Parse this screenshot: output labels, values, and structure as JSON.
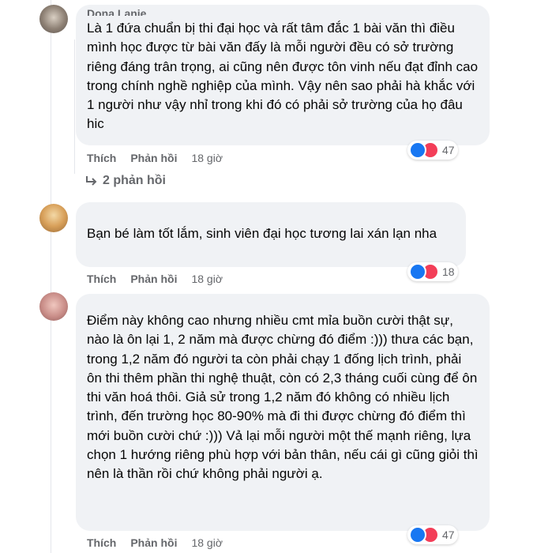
{
  "comments": [
    {
      "author": "Dona Lanie",
      "text": "Là 1 đứa chuẩn bị thi đại học và rất tâm đắc 1 bài văn thì điều mình học được từ bài văn đấy là mỗi người đều có sở trường riêng đáng trân trọng, ai cũng nên được tôn vinh nếu đạt đỉnh cao trong chính nghề nghiệp của mình. Vậy nên sao phải hà khắc với 1 người như vậy nhỉ trong khi đó có phải sở trường của họ đâu hic",
      "like_label": "Thích",
      "reply_label": "Phản hồi",
      "time": "18 giờ",
      "reaction_count": "47",
      "replies_label": "2 phản hồi"
    },
    {
      "author": "",
      "text": "Bạn bé làm tốt lắm, sinh viên đại học tương lai xán lạn nha",
      "like_label": "Thích",
      "reply_label": "Phản hồi",
      "time": "18 giờ",
      "reaction_count": "18"
    },
    {
      "author": "",
      "text": "Điểm này không cao nhưng nhiều cmt mỉa buồn cười thật sự, nào là ôn lại 1, 2 năm mà được chừng đó điểm :))) thưa các bạn, trong 1,2 năm đó người ta còn phải chạy 1 đống lịch trình, phải ôn thi thêm phần thi nghệ thuật, còn có 2,3 tháng cuối cùng để ôn thi văn hoá thôi. Giả sử trong 1,2 năm đó không có nhiều lịch trình, đến trường học 80-90% mà đi thi được chừng đó điểm thì mới buồn cười chứ :))) Vả lại mỗi người một thế mạnh riêng, lựa chọn 1 hướng riêng phù hợp với bản thân, nếu cái gì cũng giỏi thì nên là thần rồi chứ không phải người ạ.",
      "like_label": "Thích",
      "reply_label": "Phản hồi",
      "time": "18 giờ",
      "reaction_count": "47"
    }
  ],
  "colors": {
    "bubble": "#f0f2f5",
    "secondary_text": "#65676b",
    "like_blue": "#1877f2",
    "love_red": "#f33e58"
  },
  "icons": [
    "like-icon",
    "love-icon",
    "reply-arrow-icon"
  ]
}
